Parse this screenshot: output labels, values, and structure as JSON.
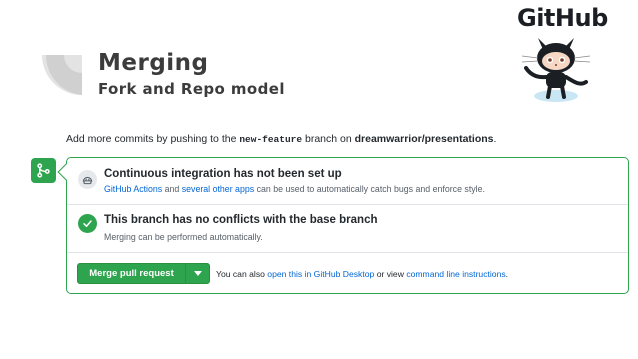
{
  "slide": {
    "title": "Merging",
    "subtitle": "Fork and Repo model",
    "logo_text": "GitHub"
  },
  "info": {
    "prefix": "Add more commits by pushing to the ",
    "branch": "new-feature",
    "middle": " branch on ",
    "repo": "dreamwarrior/presentations",
    "suffix": "."
  },
  "checks": {
    "ci": {
      "title": "Continuous integration has not been set up",
      "link1": "GitHub Actions",
      "text1": " and ",
      "link2": "several other apps",
      "text2": " can be used to automatically catch bugs and enforce style.",
      "icon": "ci-icon"
    },
    "conflicts": {
      "title": "This branch has no conflicts with the base branch",
      "desc": "Merging can be performed automatically.",
      "icon": "check-icon"
    }
  },
  "merge": {
    "button_label": "Merge pull request",
    "alt_prefix": "You can also ",
    "alt_link1": "open this in GitHub Desktop",
    "alt_middle": " or view ",
    "alt_link2": "command line instructions",
    "alt_suffix": "."
  },
  "colors": {
    "green": "#2ea44f",
    "link": "#0366d6",
    "muted": "#586069"
  }
}
